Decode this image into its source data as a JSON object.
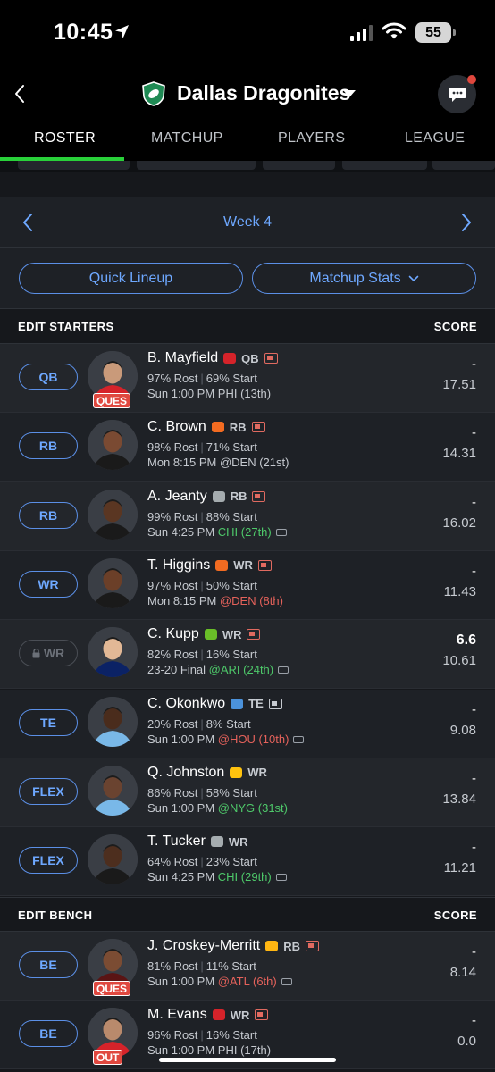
{
  "status_bar": {
    "time": "10:45",
    "battery": "55"
  },
  "header": {
    "team_name": "Dallas Dragonites"
  },
  "tabs": [
    {
      "label": "ROSTER",
      "active": true
    },
    {
      "label": "MATCHUP",
      "active": false
    },
    {
      "label": "PLAYERS",
      "active": false
    },
    {
      "label": "LEAGUE",
      "active": false
    }
  ],
  "week": {
    "label": "Week 4"
  },
  "actions": {
    "quick_lineup": "Quick Lineup",
    "matchup_stats": "Matchup Stats"
  },
  "starters": {
    "title": "EDIT STARTERS",
    "score_label": "SCORE",
    "players": [
      {
        "slot": "QB",
        "name": "B. Mayfield",
        "pos": "QB",
        "team_color": "#d5232a",
        "rost": "97% Rost",
        "start": "69% Start",
        "game_prefix": "Sun 1:00 PM",
        "opp": "PHI (13th)",
        "opp_class": "",
        "field_icon": false,
        "status": "QUES",
        "score_top": "-",
        "score_proj": "17.51",
        "news_plain": false
      },
      {
        "slot": "RB",
        "name": "C. Brown",
        "pos": "RB",
        "team_color": "#f26b21",
        "rost": "98% Rost",
        "start": "71% Start",
        "game_prefix": "Mon 8:15 PM",
        "opp": "@DEN (21st)",
        "opp_class": "",
        "field_icon": false,
        "status": "",
        "score_top": "-",
        "score_proj": "14.31",
        "news_plain": false
      },
      {
        "slot": "RB",
        "name": "A. Jeanty",
        "pos": "RB",
        "team_color": "#a5acaf",
        "rost": "99% Rost",
        "start": "88% Start",
        "game_prefix": "Sun 4:25 PM",
        "opp": "CHI (27th)",
        "opp_class": "good",
        "field_icon": true,
        "status": "",
        "score_top": "-",
        "score_proj": "16.02",
        "news_plain": false
      },
      {
        "slot": "WR",
        "name": "T. Higgins",
        "pos": "WR",
        "team_color": "#f26b21",
        "rost": "97% Rost",
        "start": "50% Start",
        "game_prefix": "Mon 8:15 PM",
        "opp": "@DEN (8th)",
        "opp_class": "bad",
        "field_icon": false,
        "status": "",
        "score_top": "-",
        "score_proj": "11.43",
        "news_plain": false
      },
      {
        "slot": "WR",
        "locked": true,
        "name": "C. Kupp",
        "pos": "WR",
        "team_color": "#69be28",
        "rost": "82% Rost",
        "start": "16% Start",
        "game_prefix": "23-20 Final",
        "opp": "@ARI (24th)",
        "opp_class": "good",
        "field_icon": true,
        "status": "",
        "score_top": "6.6",
        "score_proj": "10.61",
        "news_plain": false
      },
      {
        "slot": "TE",
        "name": "C. Okonkwo",
        "pos": "TE",
        "team_color": "#4b92db",
        "rost": "20% Rost",
        "start": "8% Start",
        "game_prefix": "Sun 1:00 PM",
        "opp": "@HOU (10th)",
        "opp_class": "bad",
        "field_icon": true,
        "status": "",
        "score_top": "-",
        "score_proj": "9.08",
        "news_plain": true
      },
      {
        "slot": "FLEX",
        "name": "Q. Johnston",
        "pos": "WR",
        "team_color": "#ffc20e",
        "rost": "86% Rost",
        "start": "58% Start",
        "game_prefix": "Sun 1:00 PM",
        "opp": "@NYG (31st)",
        "opp_class": "good",
        "field_icon": false,
        "status": "",
        "score_top": "-",
        "score_proj": "13.84",
        "news_plain": false,
        "no_news": true
      },
      {
        "slot": "FLEX",
        "name": "T. Tucker",
        "pos": "WR",
        "team_color": "#a5acaf",
        "rost": "64% Rost",
        "start": "23% Start",
        "game_prefix": "Sun 4:25 PM",
        "opp": "CHI (29th)",
        "opp_class": "good",
        "field_icon": true,
        "status": "",
        "score_top": "-",
        "score_proj": "11.21",
        "news_plain": false,
        "no_news": true
      }
    ]
  },
  "bench": {
    "title": "EDIT BENCH",
    "score_label": "SCORE",
    "players": [
      {
        "slot": "BE",
        "name": "J. Croskey-Merritt",
        "pos": "RB",
        "team_color": "#ffb612",
        "rost": "81% Rost",
        "start": "11% Start",
        "game_prefix": "Sun 1:00 PM",
        "opp": "@ATL (6th)",
        "opp_class": "bad",
        "field_icon": true,
        "status": "QUES",
        "score_top": "-",
        "score_proj": "8.14",
        "news_plain": false
      },
      {
        "slot": "BE",
        "name": "M. Evans",
        "pos": "WR",
        "team_color": "#d5232a",
        "rost": "96% Rost",
        "start": "16% Start",
        "game_prefix": "Sun 1:00 PM",
        "opp": "PHI (17th)",
        "opp_class": "",
        "field_icon": false,
        "status": "OUT",
        "score_top": "-",
        "score_proj": "0.0",
        "news_plain": false
      }
    ]
  },
  "colors": {
    "accent_blue": "#6ea8ff",
    "tab_green": "#29d13a",
    "status_red": "#e0483f"
  }
}
